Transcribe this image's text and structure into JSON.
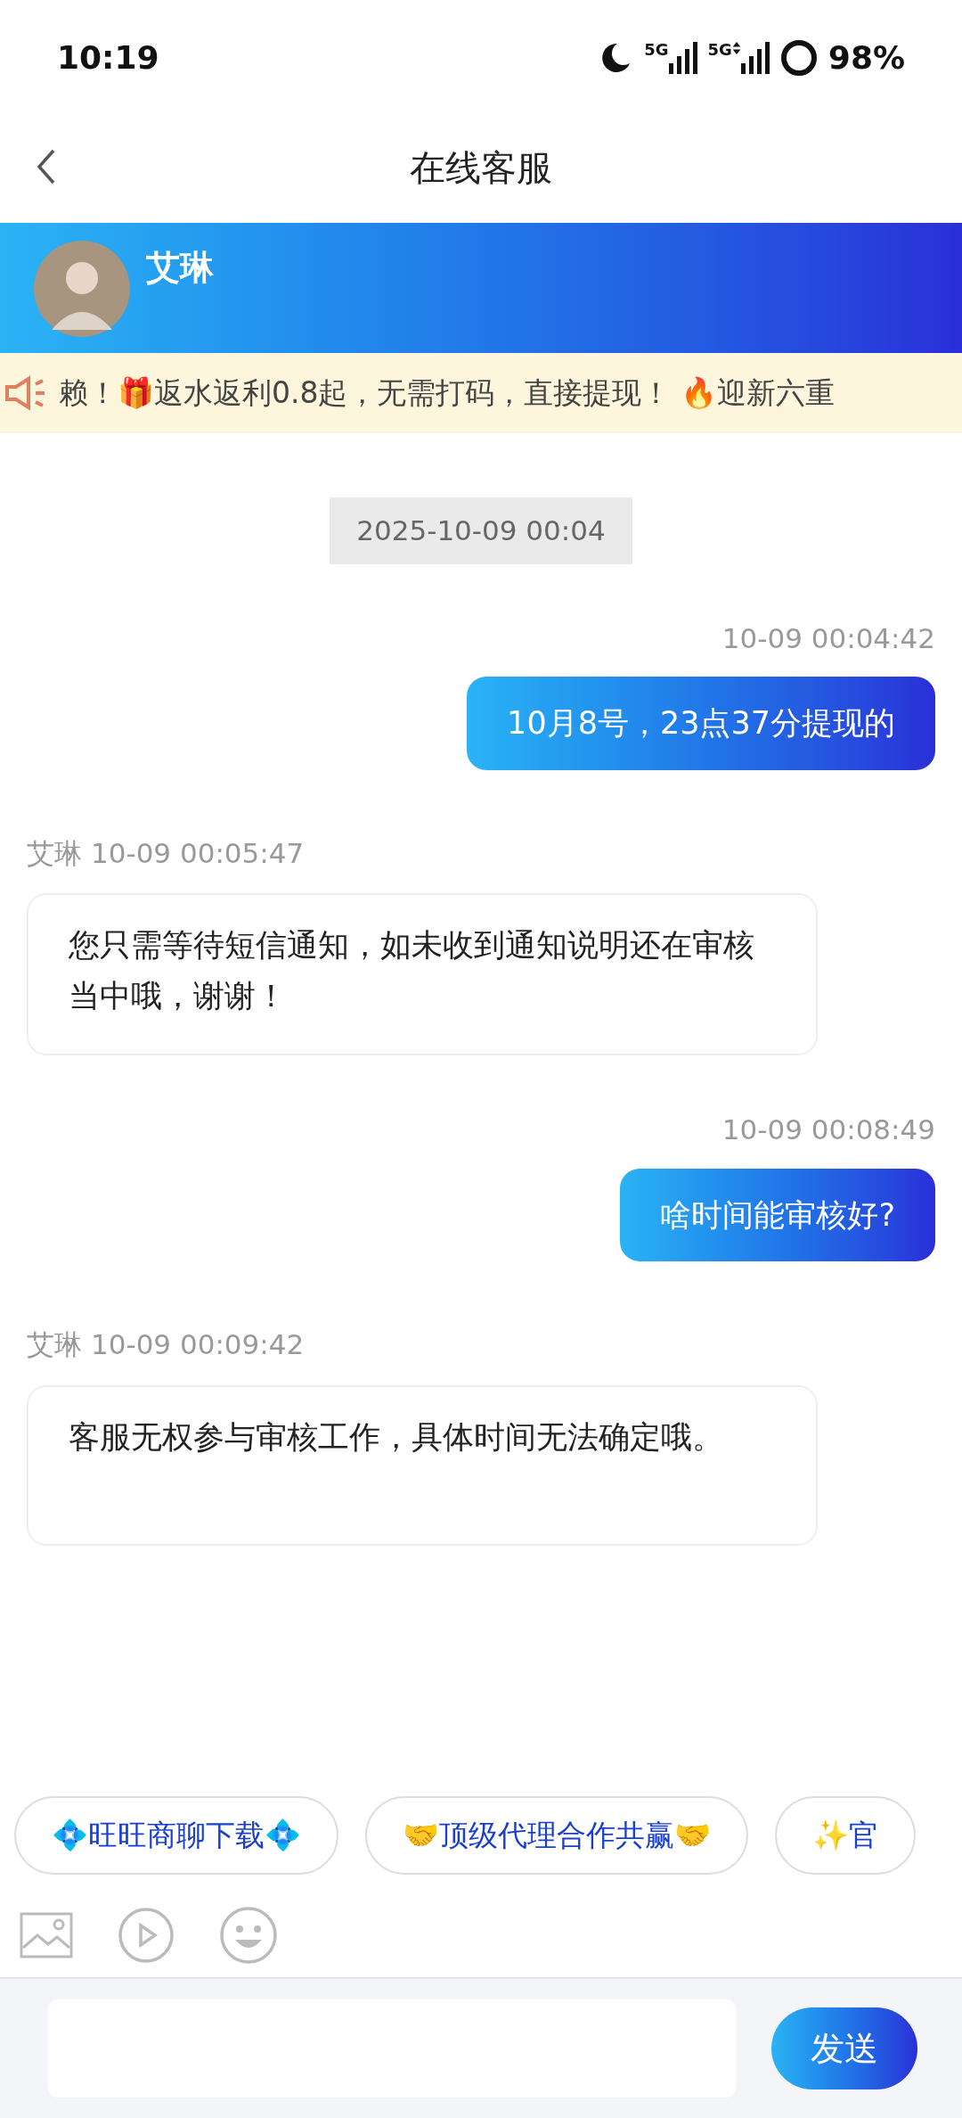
{
  "status_bar": {
    "time": "10:19",
    "battery": "98%",
    "networks": [
      "5G",
      "5G"
    ]
  },
  "header": {
    "title": "在线客服"
  },
  "agent": {
    "name": "艾琳"
  },
  "notice": {
    "text": "赖！🎁返水返利0.8起，无需打码，直接提现！ 🔥迎新六重"
  },
  "date_divider": "2025-10-09 00:04",
  "messages": [
    {
      "kind": "sent",
      "time": "10-09 00:04:42",
      "text": "10月8号，23点37分提现的"
    },
    {
      "kind": "received",
      "sender": "艾琳",
      "time": "10-09 00:05:47",
      "text": "您只需等待短信通知，如未收到通知说明还在审核当中哦，谢谢！"
    },
    {
      "kind": "sent",
      "time": "10-09 00:08:49",
      "text": "啥时间能审核好?"
    },
    {
      "kind": "received",
      "sender": "艾琳",
      "time": "10-09 00:09:42",
      "text": "客服无权参与审核工作，具体时间无法确定哦。"
    }
  ],
  "quick_replies": [
    "💠旺旺商聊下载💠",
    "🤝顶级代理合作共赢🤝",
    "✨官"
  ],
  "send_button": "发送"
}
